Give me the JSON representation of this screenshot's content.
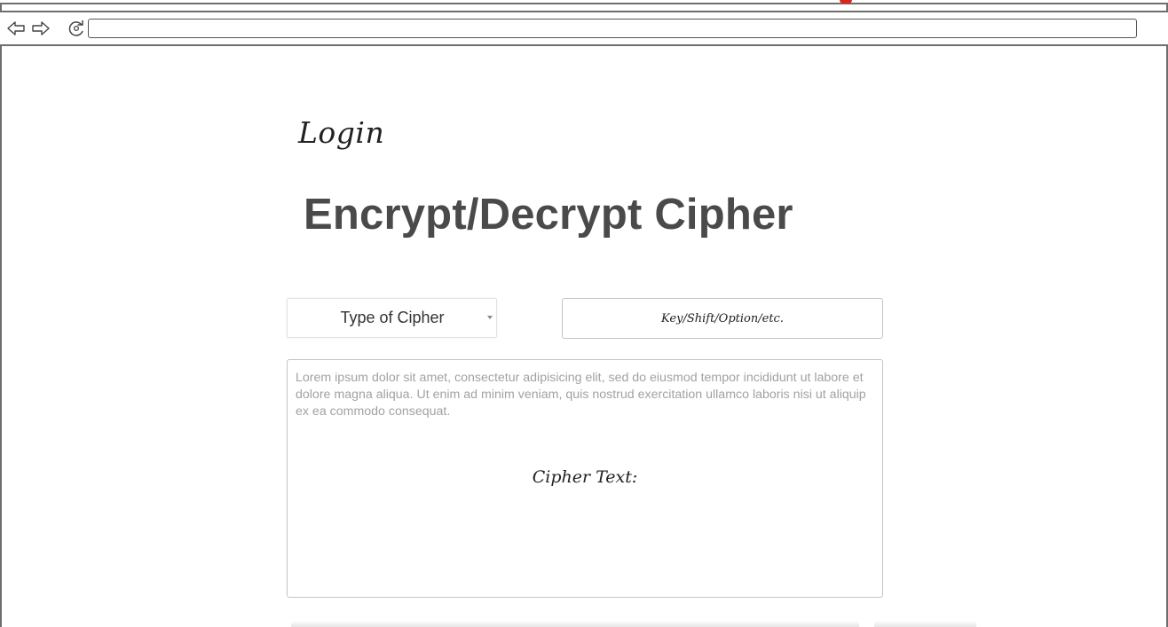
{
  "browser": {
    "back_icon": "arrow-left-icon",
    "forward_icon": "arrow-right-icon",
    "reload_icon": "reload-icon",
    "url": ""
  },
  "page": {
    "login_label": "Login",
    "title": "Encrypt/Decrypt Cipher"
  },
  "form": {
    "cipher_type": {
      "selected": "Type of Cipher",
      "icon": "caret-down-icon"
    },
    "key_field": {
      "placeholder": "Key/Shift/Option/etc."
    },
    "text_area": {
      "placeholder": "Lorem ipsum dolor sit amet, consectetur adipisicing elit, sed do eiusmod tempor incididunt ut labore et dolore magna aliqua. Ut enim ad minim veniam, quis nostrud exercitation ullamco laboris nisi ut aliquip ex ea commodo consequat.",
      "label": "Cipher Text:"
    }
  },
  "colors": {
    "title": "#4a4a4a",
    "window_frame": "#6e6e6e",
    "placeholder_text": "#a2a2a2",
    "indicator": "#e3221b"
  }
}
